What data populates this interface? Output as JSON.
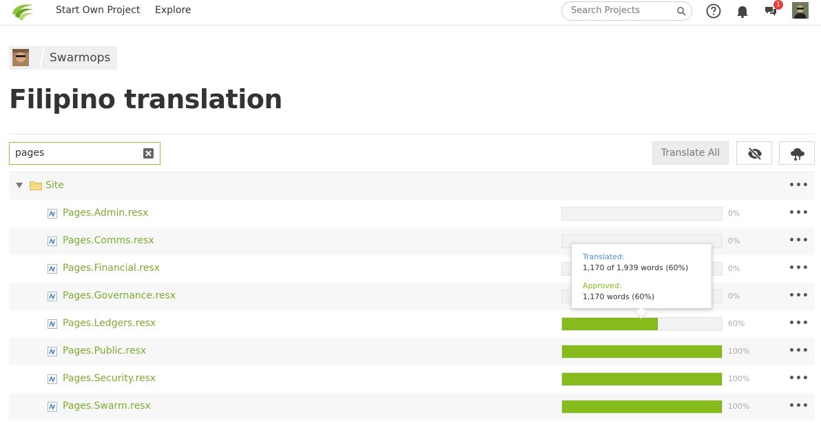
{
  "nav": {
    "start_label": "Start Own Project",
    "explore_label": "Explore",
    "search_placeholder": "Search Projects",
    "notification_count": "1"
  },
  "breadcrumb": {
    "name": "Swarmops"
  },
  "page": {
    "title": "Filipino translation"
  },
  "toolbar": {
    "filter_value": "pages",
    "translate_all_label": "Translate All"
  },
  "tree": {
    "folder": {
      "label": "Site"
    },
    "files": [
      {
        "name": "Pages.Admin.resx",
        "percent_label": "0%",
        "progress": 0
      },
      {
        "name": "Pages.Comms.resx",
        "percent_label": "0%",
        "progress": 0
      },
      {
        "name": "Pages.Financial.resx",
        "percent_label": "0%",
        "progress": 0
      },
      {
        "name": "Pages.Governance.resx",
        "percent_label": "0%",
        "progress": 0
      },
      {
        "name": "Pages.Ledgers.resx",
        "percent_label": "60%",
        "progress": 0.6
      },
      {
        "name": "Pages.Public.resx",
        "percent_label": "100%",
        "progress": 1.0
      },
      {
        "name": "Pages.Security.resx",
        "percent_label": "100%",
        "progress": 1.0
      },
      {
        "name": "Pages.Swarm.resx",
        "percent_label": "100%",
        "progress": 1.0
      }
    ]
  },
  "tooltip": {
    "translated_label": "Translated:",
    "translated_value": "1,170 of 1,939 words (60%)",
    "approved_label": "Approved:",
    "approved_value": "1,170 words (60%)"
  },
  "colors": {
    "accent_green": "#86bb1c",
    "link_green": "#7cac2f",
    "translated_blue": "#4a90d9",
    "badge_red": "#e5413c"
  },
  "icons": [
    "logo-icon",
    "search-icon",
    "help-icon",
    "bell-icon",
    "chat-icon",
    "eye-slash-icon",
    "cloud-sync-icon",
    "folder-icon",
    "resx-file-icon",
    "more-icon",
    "caret-down-icon",
    "clear-icon"
  ]
}
